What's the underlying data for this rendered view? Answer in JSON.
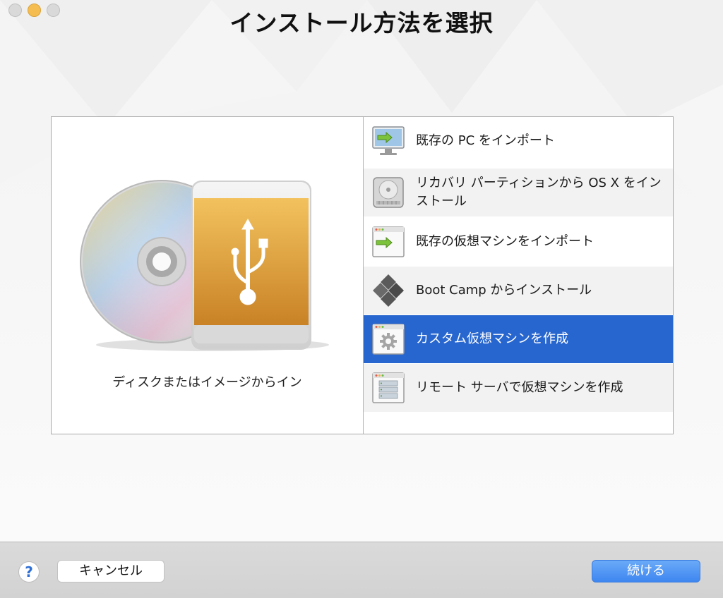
{
  "window": {
    "title": "インストール方法を選択"
  },
  "left_pane": {
    "caption": "ディスクまたはイメージからイン"
  },
  "options": [
    {
      "label": "既存の PC をインポート",
      "icon": "monitor-import-icon",
      "selected": false
    },
    {
      "label": "リカバリ パーティションから OS X をインストール",
      "icon": "hard-drive-icon",
      "selected": false
    },
    {
      "label": "既存の仮想マシンをインポート",
      "icon": "vm-import-icon",
      "selected": false
    },
    {
      "label": "Boot Camp からインストール",
      "icon": "boot-camp-icon",
      "selected": false
    },
    {
      "label": "カスタム仮想マシンを作成",
      "icon": "gear-window-icon",
      "selected": true
    },
    {
      "label": "リモート サーバで仮想マシンを作成",
      "icon": "server-window-icon",
      "selected": false
    }
  ],
  "footer": {
    "help_label": "?",
    "cancel_label": "キャンセル",
    "continue_label": "続ける"
  },
  "colors": {
    "selection": "#2866cf",
    "primary_button": "#3e86f0",
    "usb_body": "#e3a035"
  }
}
